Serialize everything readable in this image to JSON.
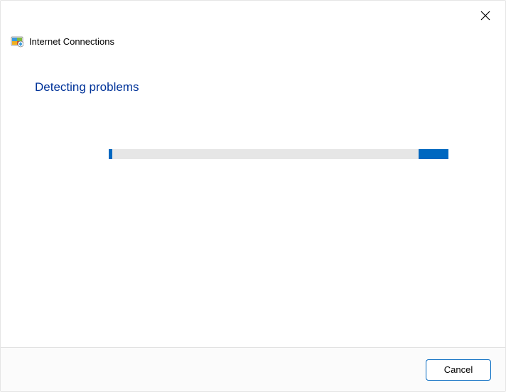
{
  "window": {
    "title": "Internet Connections"
  },
  "content": {
    "heading": "Detecting problems"
  },
  "footer": {
    "cancel_label": "Cancel"
  },
  "icons": {
    "close": "close-icon",
    "troubleshooter": "troubleshooter-icon"
  },
  "colors": {
    "accent": "#0067c0",
    "heading": "#003399",
    "progress_track": "#e6e6e6"
  }
}
